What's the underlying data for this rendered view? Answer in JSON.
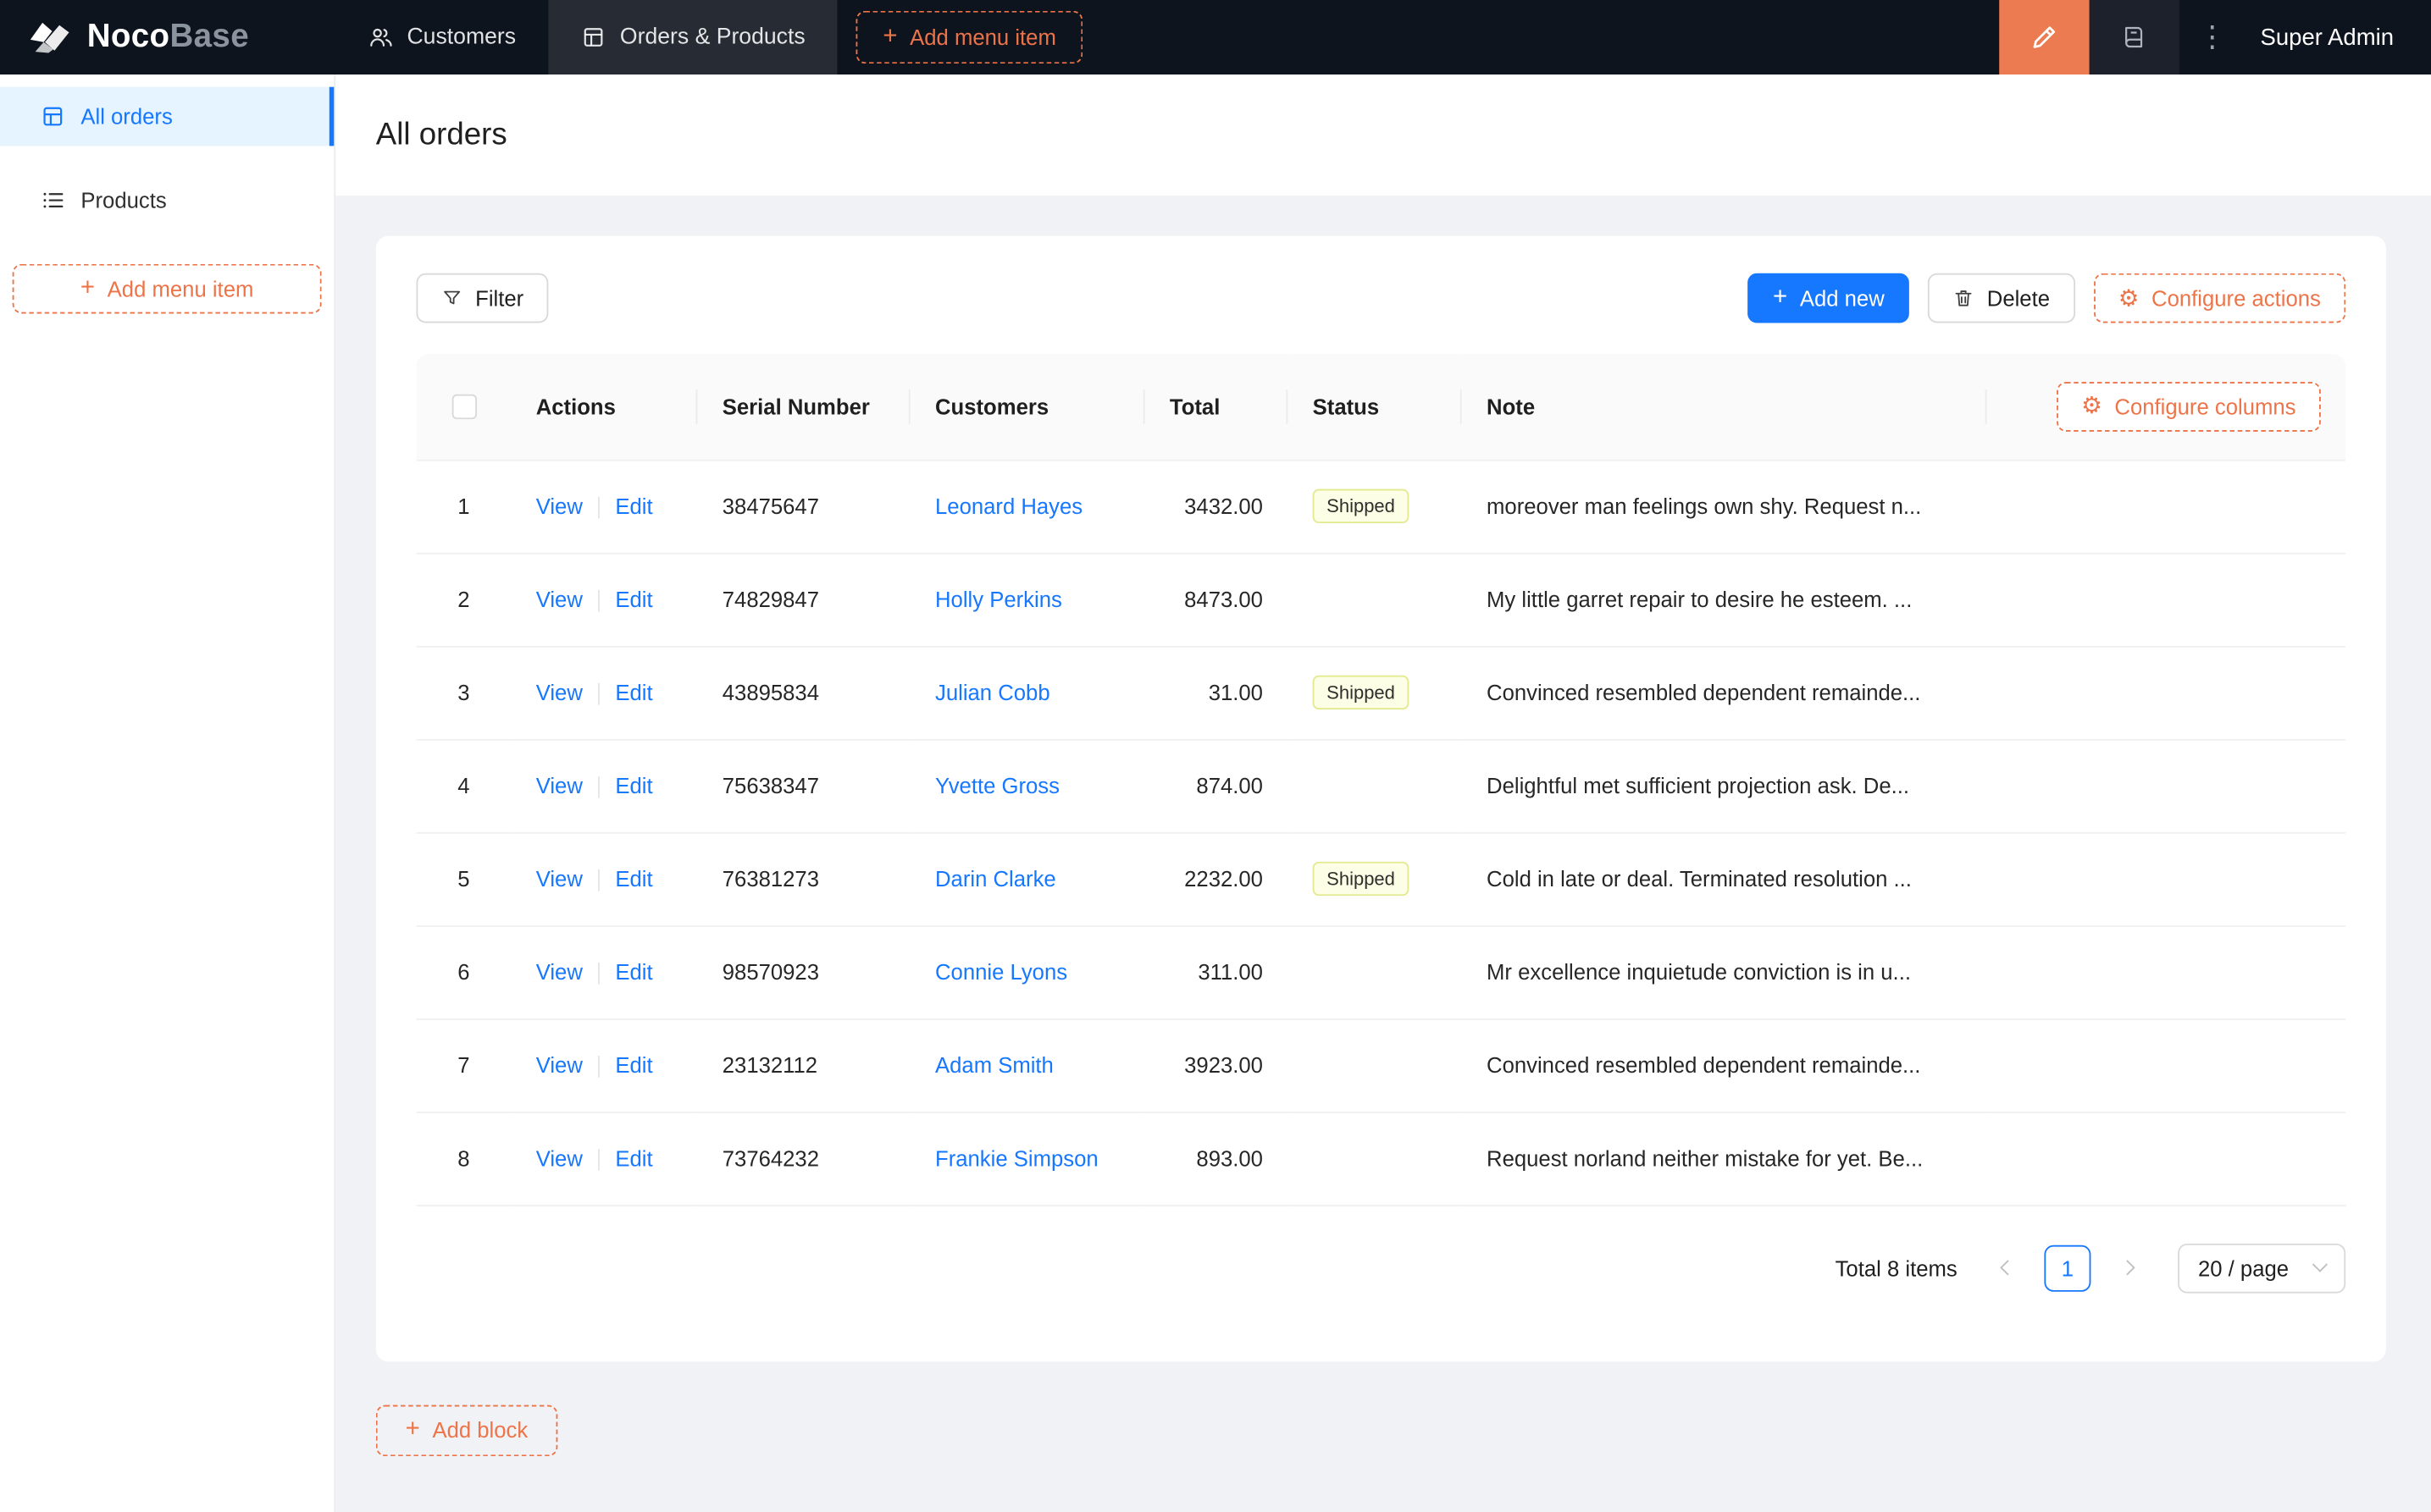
{
  "colors": {
    "header_bg": "#0e141e",
    "accent_orange": "#ed7449",
    "designer_button_bg": "#ed7b52",
    "primary_blue": "#1677ff",
    "sidebar_active_bg": "#e6f4ff",
    "content_bg": "#f0f2f5",
    "status_shipped_bg": "#fcffe6",
    "status_shipped_border": "#e3e98f"
  },
  "icons": {
    "plus": "+",
    "gear": "⚙",
    "more_vertical": "⋮"
  },
  "header": {
    "brand_primary": "Noco",
    "brand_secondary": "Base",
    "nav": [
      {
        "label": "Customers"
      },
      {
        "label": "Orders & Products"
      }
    ],
    "add_menu_item_label": "Add menu item",
    "user_name": "Super Admin"
  },
  "sidebar": {
    "items": [
      {
        "label": "All orders"
      },
      {
        "label": "Products"
      }
    ],
    "add_menu_item_label": "Add menu item"
  },
  "page": {
    "title": "All orders"
  },
  "toolbar": {
    "filter_label": "Filter",
    "add_new_label": "Add new",
    "delete_label": "Delete",
    "configure_actions_label": "Configure actions"
  },
  "table": {
    "columns": {
      "actions": "Actions",
      "serial_number": "Serial Number",
      "customers": "Customers",
      "total": "Total",
      "status": "Status",
      "note": "Note"
    },
    "configure_columns_label": "Configure columns",
    "action_labels": {
      "view": "View",
      "edit": "Edit"
    },
    "rows": [
      {
        "index": "1",
        "serial": "38475647",
        "customer": "Leonard Hayes",
        "total": "3432.00",
        "status": "Shipped",
        "note": "moreover man feelings own shy. Request n..."
      },
      {
        "index": "2",
        "serial": "74829847",
        "customer": "Holly Perkins",
        "total": "8473.00",
        "status": "",
        "note": "My little garret repair to desire he esteem. ..."
      },
      {
        "index": "3",
        "serial": "43895834",
        "customer": "Julian Cobb",
        "total": "31.00",
        "status": "Shipped",
        "note": "Convinced resembled dependent remainde..."
      },
      {
        "index": "4",
        "serial": "75638347",
        "customer": "Yvette Gross",
        "total": "874.00",
        "status": "",
        "note": "Delightful met sufficient projection ask. De..."
      },
      {
        "index": "5",
        "serial": "76381273",
        "customer": "Darin Clarke",
        "total": "2232.00",
        "status": "Shipped",
        "note": "Cold in late or deal. Terminated resolution ..."
      },
      {
        "index": "6",
        "serial": "98570923",
        "customer": "Connie Lyons",
        "total": "311.00",
        "status": "",
        "note": "Mr excellence inquietude conviction is in u..."
      },
      {
        "index": "7",
        "serial": "23132112",
        "customer": "Adam Smith",
        "total": "3923.00",
        "status": "",
        "note": "Convinced resembled dependent remainde..."
      },
      {
        "index": "8",
        "serial": "73764232",
        "customer": "Frankie Simpson",
        "total": "893.00",
        "status": "",
        "note": "Request norland neither mistake for yet. Be..."
      }
    ]
  },
  "pagination": {
    "total_label": "Total 8 items",
    "current_page": "1",
    "page_size_label": "20 / page"
  },
  "footer": {
    "add_block_label": "Add block"
  }
}
